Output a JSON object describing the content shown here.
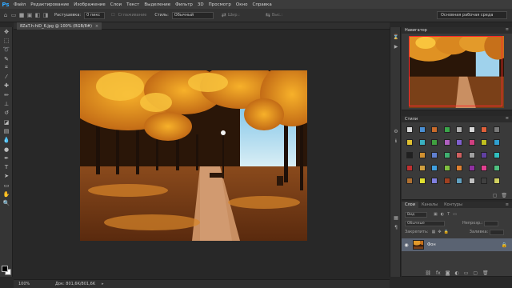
{
  "menubar": {
    "logo": "Ps",
    "items": [
      "Файл",
      "Редактирование",
      "Изображение",
      "Слои",
      "Текст",
      "Выделение",
      "Фильтр",
      "3D",
      "Просмотр",
      "Окно",
      "Справка"
    ]
  },
  "options": {
    "feather_label": "Растушевка:",
    "feather_value": "0 пикс",
    "antialias_label": "Сглаживание",
    "style_label": "Стиль:",
    "style_value": "Обычный",
    "width_label": "Шир.:",
    "height_label": "Выс.:",
    "workspace": "Основная рабочая среда"
  },
  "document": {
    "tab_title": "8ZaT.h-hiD_6.jpg @ 100% (RGB/8#)",
    "close": "×"
  },
  "status": {
    "zoom": "100%",
    "doc_size": "Док: 801,6K/801,6K",
    "arrow": "▸"
  },
  "panels": {
    "navigator": {
      "title": "Навигатор",
      "menu": "≡"
    },
    "styles": {
      "title": "Стили",
      "menu": "≡"
    },
    "layers": {
      "tabs": [
        "Слои",
        "Каналы",
        "Контуры"
      ],
      "kind_label": "Вид",
      "blend_mode": "Обычные",
      "opacity_label": "Непрозр.:",
      "lock_label": "Закрепить:",
      "fill_label": "Заливка:",
      "layer_name": "Фон",
      "lock_icon": "🔒",
      "menu": "≡"
    }
  },
  "colors": {
    "ui_dark": "#282828",
    "panel": "#3a3a3a",
    "selection": "#5a6372",
    "accent": "#31a8ff",
    "nav_box": "#ff2a2a"
  }
}
